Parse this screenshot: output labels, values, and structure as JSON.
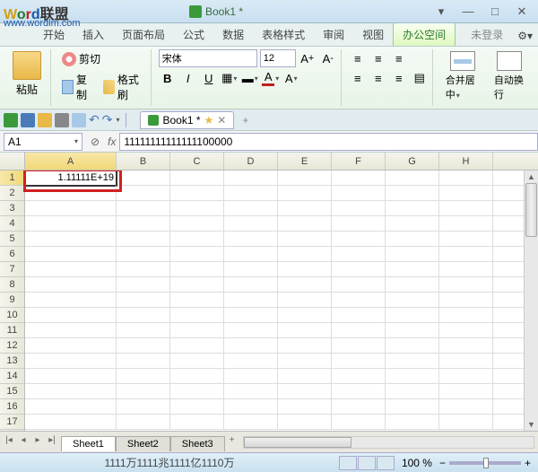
{
  "watermark": {
    "brand_text": "联盟",
    "url": "www.wordlm.com"
  },
  "titlebar": {
    "filename": "Book1 *"
  },
  "menu": {
    "tabs": [
      "开始",
      "插入",
      "页面布局",
      "公式",
      "数据",
      "表格样式",
      "审阅",
      "视图",
      "办公空间"
    ],
    "active_index": 8,
    "login": "未登录"
  },
  "ribbon": {
    "paste": "粘贴",
    "cut": "剪切",
    "copy": "复制",
    "format_painter": "格式刷",
    "font": "宋体",
    "font_size": "12",
    "merge_center": "合并居中",
    "wrap_text": "自动换行"
  },
  "doc_tab": {
    "label": "Book1 *"
  },
  "formula_bar": {
    "cell_ref": "A1",
    "fx": "fx",
    "value": "11111111111111100000"
  },
  "grid": {
    "columns": [
      "A",
      "B",
      "C",
      "D",
      "E",
      "F",
      "G",
      "H"
    ],
    "visible_rows": 17,
    "a1_display": "1.11111E+19"
  },
  "sheets": {
    "tabs": [
      "Sheet1",
      "Sheet2",
      "Sheet3"
    ],
    "active": 0
  },
  "status": {
    "caps_text": "1111万1111兆1111亿1110万",
    "zoom": "100 %"
  }
}
